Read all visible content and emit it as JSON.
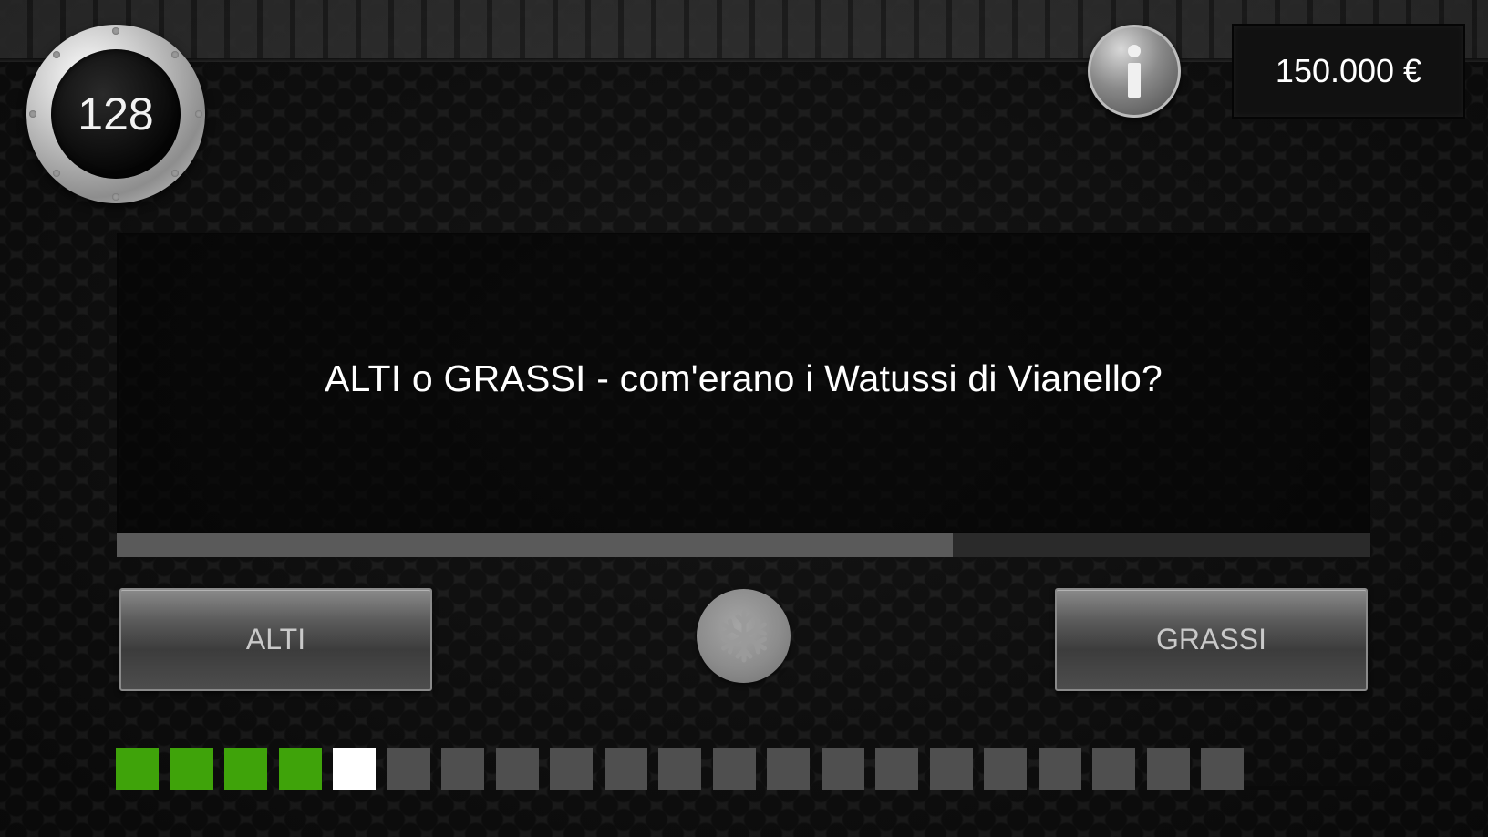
{
  "dial": {
    "value": "128"
  },
  "prize": {
    "label": "150.000 €"
  },
  "question": {
    "text": "ALTI o GRASSI - com'erano i Watussi di Vianello?"
  },
  "timer": {
    "fraction": 0.667
  },
  "answers": {
    "left": "ALTI",
    "right": "GRASSI"
  },
  "icons": {
    "info": "info-icon",
    "freeze": "snowflake-icon"
  },
  "colors": {
    "correct": "#3fa30a",
    "current": "#ffffff",
    "pending": "#4f4f4f"
  },
  "progress": {
    "total": 21,
    "states": [
      "correct",
      "correct",
      "correct",
      "correct",
      "current",
      "pending",
      "pending",
      "pending",
      "pending",
      "pending",
      "pending",
      "pending",
      "pending",
      "pending",
      "pending",
      "pending",
      "pending",
      "pending",
      "pending",
      "pending",
      "pending"
    ]
  }
}
